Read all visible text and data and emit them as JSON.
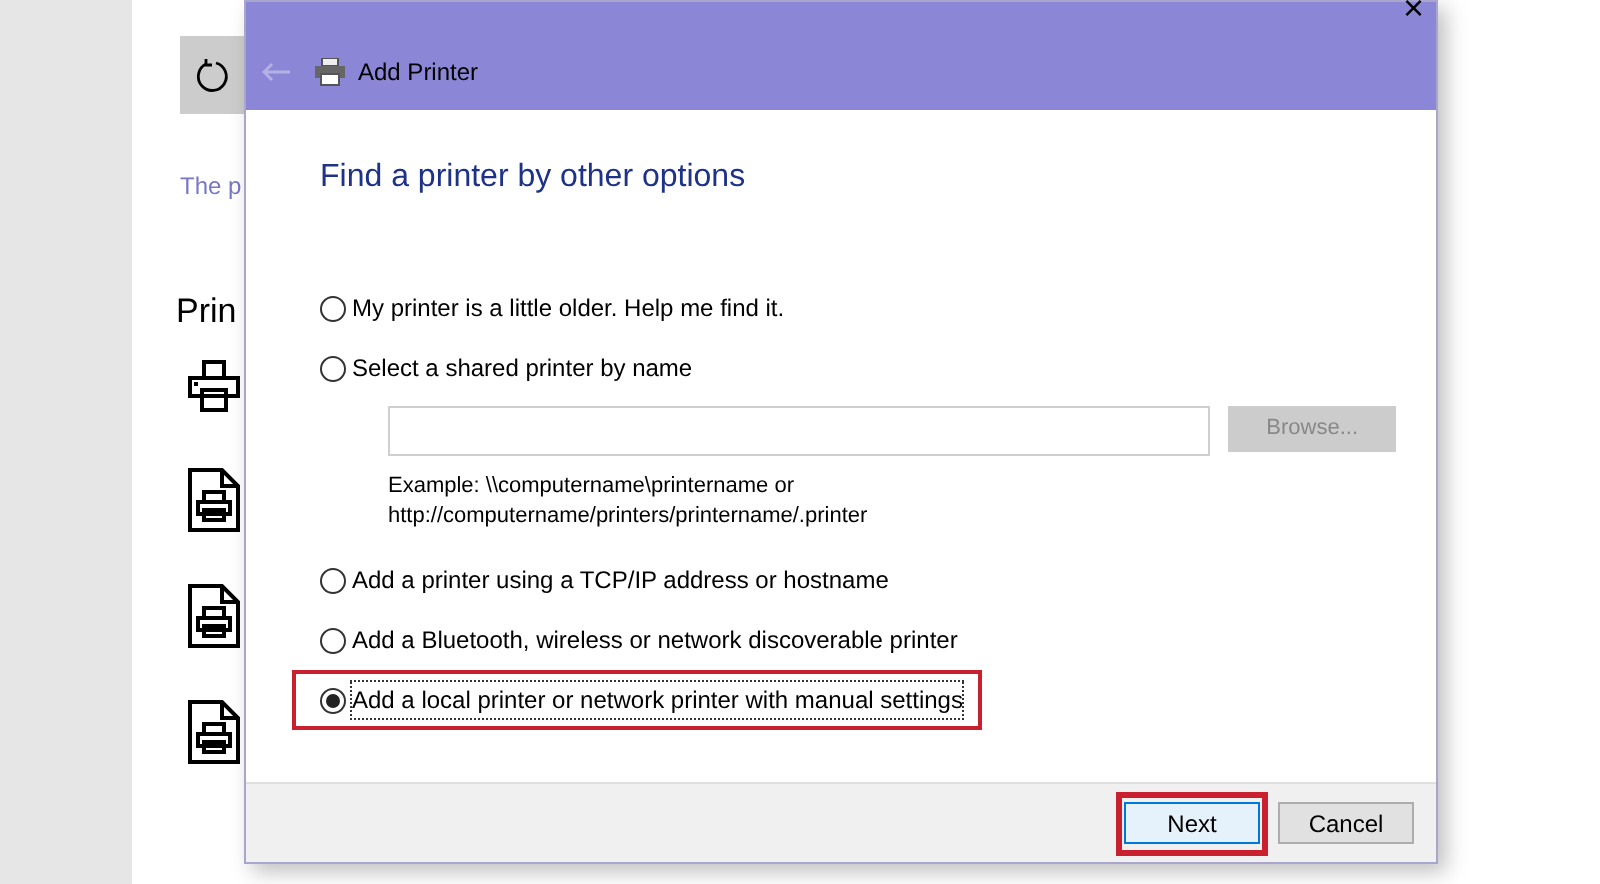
{
  "background_page": {
    "intro_text": "The p",
    "heading": "Prin",
    "printers": [
      {
        "kind": "device"
      },
      {
        "kind": "document"
      },
      {
        "kind": "document"
      },
      {
        "kind": "document"
      }
    ]
  },
  "dialog": {
    "title": "Add Printer",
    "close_label": "×",
    "heading": "Find a printer by other options",
    "options": [
      {
        "label": "My printer is a little older. Help me find it.",
        "selected": false,
        "highlighted": false
      },
      {
        "label": "Select a shared printer by name",
        "selected": false,
        "highlighted": false,
        "field": {
          "browse_label": "Browse...",
          "browse_disabled": true,
          "example": "Example: \\\\computername\\printername or",
          "example_2": "http://computername/printers/printername/.printer"
        }
      },
      {
        "label": "Add a printer using a TCP/IP address or hostname",
        "selected": false,
        "highlighted": false
      },
      {
        "label": "Add a Bluetooth, wireless or network discoverable printer",
        "selected": false,
        "highlighted": false
      },
      {
        "label": "Add a local printer or network printer with manual settings",
        "selected": true,
        "highlighted": true
      }
    ],
    "buttons": [
      {
        "label": "Next",
        "default": true,
        "highlighted": true
      },
      {
        "label": "Cancel",
        "default": false,
        "highlighted": false
      }
    ]
  }
}
